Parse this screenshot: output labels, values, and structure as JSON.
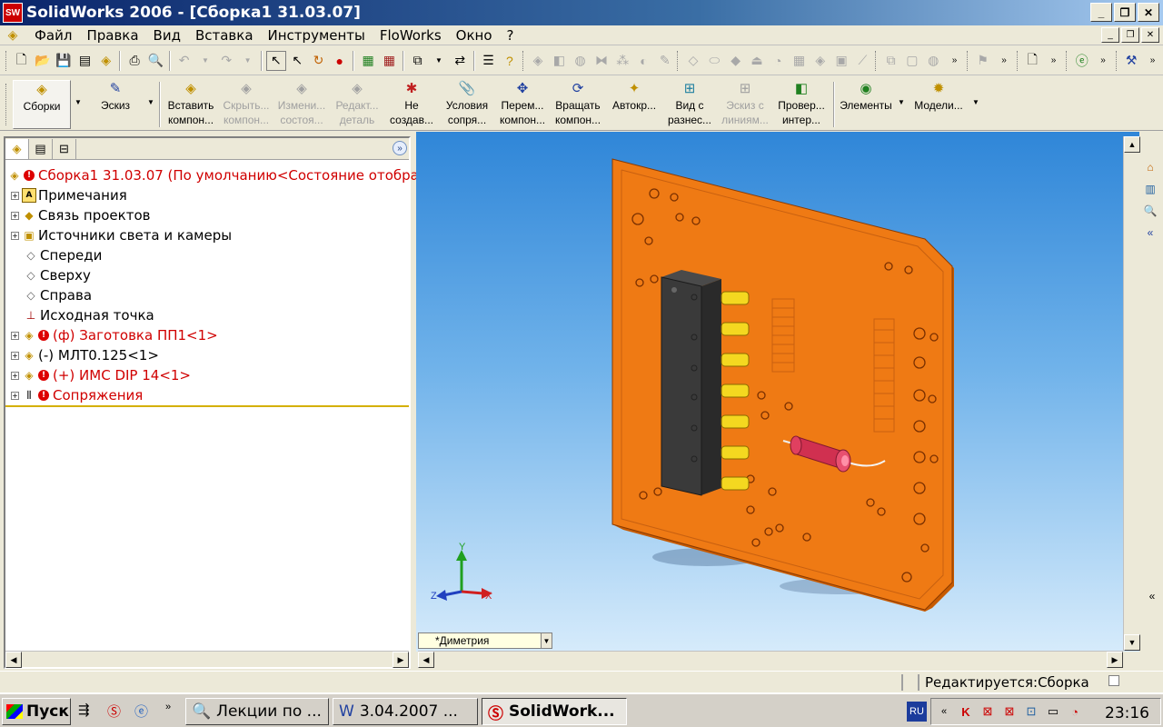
{
  "window": {
    "title": "SolidWorks 2006 - [Сборка1 31.03.07]",
    "app_icon_label": "SW"
  },
  "menu": [
    "Файл",
    "Правка",
    "Вид",
    "Вставка",
    "Инструменты",
    "FloWorks",
    "Окно",
    "?"
  ],
  "commands": {
    "assemblies": "Сборки",
    "sketch": "Эскиз",
    "insert_component": "Вставить компон...",
    "hide_component": "Скрыть... компон...",
    "change_state": "Измени... состоя...",
    "edit_part": "Редакт... деталь",
    "no_create": "Не создав...",
    "mates": "Условия сопря...",
    "move_component": "Перем... компон...",
    "rotate_component": "Вращать компон...",
    "autocomp": "Автокр...",
    "exploded_view": "Вид с разнес...",
    "sketch_lines": "Эскиз с линиям...",
    "check_interference": "Провер... интер...",
    "features": "Элементы",
    "models": "Модели..."
  },
  "tree": {
    "root": "Сборка1 31.03.07  (По умолчанию<Состояние отобра",
    "items": [
      {
        "label": "Примечания"
      },
      {
        "label": "Связь проектов"
      },
      {
        "label": "Источники света и камеры"
      },
      {
        "label": "Спереди"
      },
      {
        "label": "Сверху"
      },
      {
        "label": "Справа"
      },
      {
        "label": "Исходная точка"
      },
      {
        "label": "(ф) Заготовка ПП1<1>"
      },
      {
        "label": "(-) МЛТ0.125<1>"
      },
      {
        "label": "(+) ИМС DIP 14<1>"
      },
      {
        "label": "Сопряжения"
      }
    ]
  },
  "viewport": {
    "view_orientation": "*Диметрия",
    "axes": {
      "x": "X",
      "y": "Y",
      "z": "Z"
    }
  },
  "status": {
    "text": "Редактируется:Сборка"
  },
  "taskbar": {
    "start": "Пуск",
    "tasks": [
      "Лекции по ...",
      "3.04.2007 ...",
      "SolidWork..."
    ],
    "language": "RU",
    "clock": "23:16"
  }
}
